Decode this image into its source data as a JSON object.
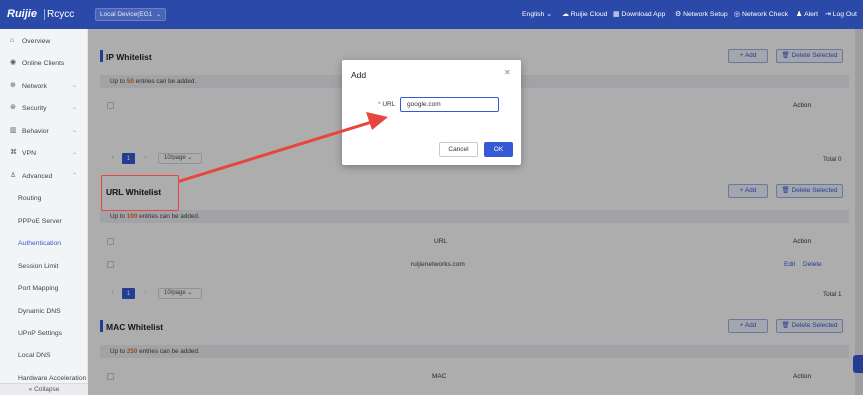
{
  "header": {
    "brand": "Ruijie",
    "brand2": "Rcycc",
    "device": "Local Device(EG1",
    "language": "English",
    "nav": [
      {
        "label": "Ruijie Cloud",
        "icon": "cloud-icon"
      },
      {
        "label": "Download App",
        "icon": "download-icon"
      },
      {
        "label": "Network Setup",
        "icon": "network-setup-icon"
      },
      {
        "label": "Network Check",
        "icon": "network-check-icon"
      },
      {
        "label": "Alert",
        "icon": "alert-icon"
      },
      {
        "label": "Log Out",
        "icon": "logout-icon"
      }
    ]
  },
  "sidebar": {
    "items": [
      {
        "label": "Overview",
        "icon": "overview-icon"
      },
      {
        "label": "Online Clients",
        "icon": "clients-icon"
      },
      {
        "label": "Network",
        "icon": "network-icon"
      },
      {
        "label": "Security",
        "icon": "security-icon"
      },
      {
        "label": "Behavior",
        "icon": "behavior-icon"
      },
      {
        "label": "VPN",
        "icon": "vpn-icon"
      },
      {
        "label": "Advanced",
        "icon": "advanced-icon"
      }
    ],
    "subitems": [
      "Routing",
      "PPPoE Server",
      "Authentication",
      "Session Limit",
      "Port Mapping",
      "Dynamic DNS",
      "UPnP Settings",
      "Local DNS",
      "Hardware Acceleration"
    ],
    "collapse": "Collapse"
  },
  "ip_whitelist": {
    "title": "IP Whitelist",
    "add": "+ Add",
    "delete": "Delete Selected",
    "hint_pre": "Up to",
    "hint_num": "50",
    "hint_post": "entries can be added.",
    "col_action": "Action",
    "page": "1",
    "page_size": "10/page",
    "total": "Total 0"
  },
  "url_whitelist": {
    "title": "URL Whitelist",
    "add": "+ Add",
    "delete": "Delete Selected",
    "hint_pre": "Up to",
    "hint_num": "100",
    "hint_post": "entries can be added.",
    "col_url": "URL",
    "col_action": "Action",
    "rows": [
      {
        "url": "ruijienetworks.com",
        "edit": "Edit",
        "delete": "Delete"
      }
    ],
    "page": "1",
    "page_size": "10/page",
    "total": "Total 1"
  },
  "mac_whitelist": {
    "title": "MAC Whitelist",
    "add": "+ Add",
    "delete": "Delete Selected",
    "hint_pre": "Up to",
    "hint_num": "250",
    "hint_post": "entries can be added.",
    "col_mac": "MAC",
    "col_action": "Action"
  },
  "modal": {
    "title": "Add",
    "url_label": "URL",
    "url_value": "google.com",
    "cancel": "Cancel",
    "ok": "OK"
  },
  "colors": {
    "accent": "#3659d6",
    "topbar": "#2b49a8",
    "annotation": "#e8453c",
    "hint_number": "#e2731a"
  }
}
